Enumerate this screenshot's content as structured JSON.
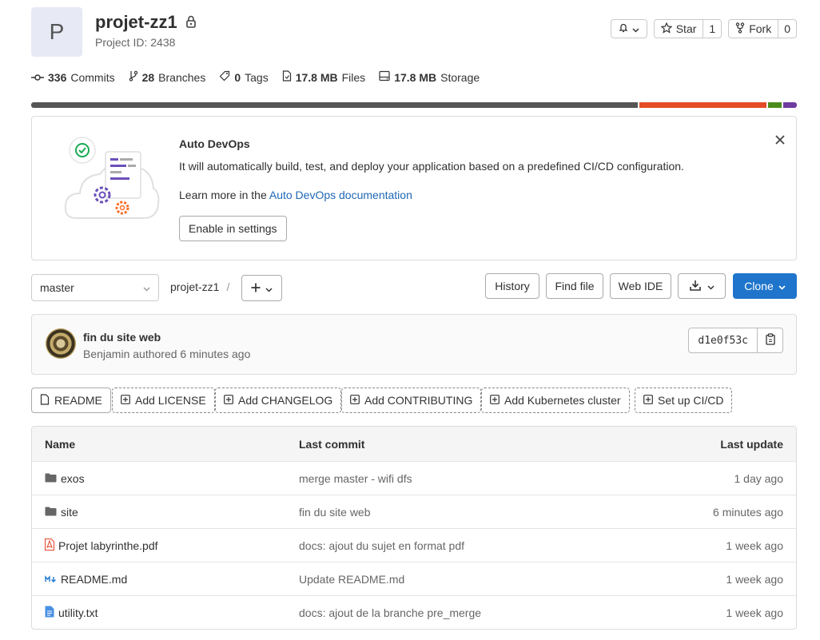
{
  "project": {
    "avatar_letter": "P",
    "name": "projet-zz1",
    "id_text": "Project ID: 2438"
  },
  "header_buttons": {
    "star_label": "Star",
    "star_count": "1",
    "fork_label": "Fork",
    "fork_count": "0"
  },
  "stats": [
    {
      "value": "336",
      "label": "Commits",
      "icon": "commit-icon"
    },
    {
      "value": "28",
      "label": "Branches",
      "icon": "branch-icon"
    },
    {
      "value": "0",
      "label": "Tags",
      "icon": "tag-icon"
    },
    {
      "value": "17.8 MB",
      "label": "Files",
      "icon": "file-icon"
    },
    {
      "value": "17.8 MB",
      "label": "Storage",
      "icon": "storage-icon"
    }
  ],
  "language_bar": [
    {
      "color": "#555555",
      "fraction": 0.797
    },
    {
      "color": "#e34c26",
      "fraction": 0.167
    },
    {
      "color": "#4a8c1c",
      "fraction": 0.018
    },
    {
      "color": "#6e3b9e",
      "fraction": 0.018
    }
  ],
  "devops": {
    "title": "Auto DevOps",
    "description": "It will automatically build, test, and deploy your application based on a predefined CI/CD configuration.",
    "learn_prefix": "Learn more in the ",
    "learn_link": "Auto DevOps documentation",
    "enable_label": "Enable in settings"
  },
  "toolbar": {
    "branch": "master",
    "breadcrumb_root": "projet-zz1",
    "breadcrumb_sep": "/",
    "history": "History",
    "find_file": "Find file",
    "web_ide": "Web IDE",
    "clone": "Clone"
  },
  "last_commit": {
    "message": "fin du site web",
    "meta": "Benjamin authored 6 minutes ago",
    "sha": "d1e0f53c"
  },
  "quick_links": [
    {
      "label": "README",
      "style": "solid",
      "icon": "file-icon"
    },
    {
      "label": "Add LICENSE",
      "style": "dashed",
      "icon": "plus-square-icon"
    },
    {
      "label": "Add CHANGELOG",
      "style": "dashed",
      "icon": "plus-square-icon"
    },
    {
      "label": "Add CONTRIBUTING",
      "style": "dashed",
      "icon": "plus-square-icon"
    },
    {
      "label": "Add Kubernetes cluster",
      "style": "dashed",
      "icon": "plus-square-icon"
    },
    {
      "label": "Set up CI/CD",
      "style": "dashed",
      "icon": "plus-square-icon"
    }
  ],
  "file_table": {
    "headers": [
      "Name",
      "Last commit",
      "Last update"
    ],
    "rows": [
      {
        "name": "exos",
        "type": "folder",
        "commit": "merge master - wifi dfs",
        "updated": "1 day ago"
      },
      {
        "name": "site",
        "type": "folder",
        "commit": "fin du site web",
        "updated": "6 minutes ago"
      },
      {
        "name": "Projet labyrinthe.pdf",
        "type": "pdf",
        "commit": "docs: ajout du sujet en format pdf",
        "updated": "1 week ago"
      },
      {
        "name": "README.md",
        "type": "markdown",
        "commit": "Update README.md",
        "updated": "1 week ago"
      },
      {
        "name": "utility.txt",
        "type": "text",
        "commit": "docs: ajout de la branche pre_merge",
        "updated": "1 week ago"
      }
    ]
  }
}
